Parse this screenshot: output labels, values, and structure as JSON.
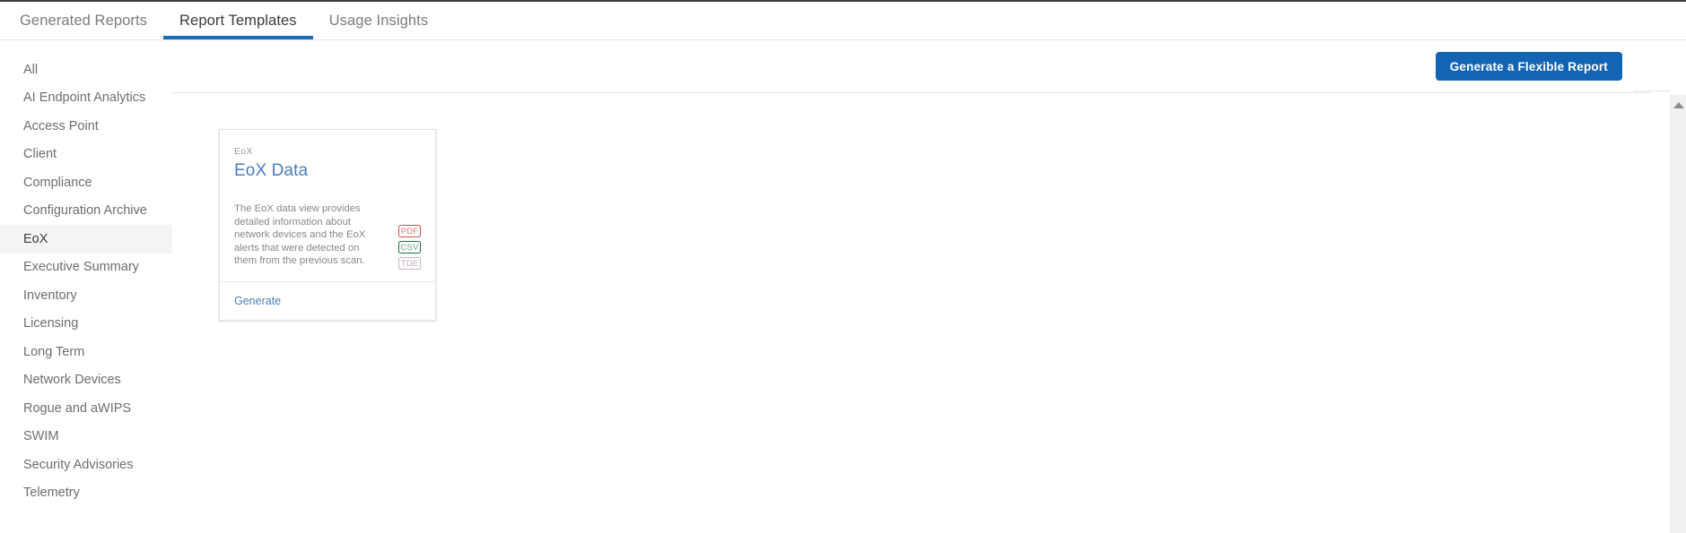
{
  "window": {
    "accent_blue": "#1464b4",
    "link_blue": "#4a7ebb",
    "tab_underline": "#1a6cb0"
  },
  "tabs": [
    {
      "label": "Generated Reports",
      "active": false
    },
    {
      "label": "Report Templates",
      "active": true
    },
    {
      "label": "Usage Insights",
      "active": false
    }
  ],
  "sidebar": {
    "items": [
      {
        "label": "All",
        "selected": false
      },
      {
        "label": "AI Endpoint Analytics",
        "selected": false
      },
      {
        "label": "Access Point",
        "selected": false
      },
      {
        "label": "Client",
        "selected": false
      },
      {
        "label": "Compliance",
        "selected": false
      },
      {
        "label": "Configuration Archive",
        "selected": false
      },
      {
        "label": "EoX",
        "selected": true
      },
      {
        "label": "Executive Summary",
        "selected": false
      },
      {
        "label": "Inventory",
        "selected": false
      },
      {
        "label": "Licensing",
        "selected": false
      },
      {
        "label": "Long Term",
        "selected": false
      },
      {
        "label": "Network Devices",
        "selected": false
      },
      {
        "label": "Rogue and aWIPS",
        "selected": false
      },
      {
        "label": "SWIM",
        "selected": false
      },
      {
        "label": "Security Advisories",
        "selected": false
      },
      {
        "label": "Telemetry",
        "selected": false
      }
    ]
  },
  "toolbar": {
    "generate_flexible_report_label": "Generate a Flexible Report"
  },
  "cards": [
    {
      "category": "EoX",
      "title": "EoX Data",
      "description": "The EoX data view provides detailed information about network devices and the EoX alerts that were detected on them from the previous scan.",
      "formats": [
        {
          "label": "PDF",
          "border": "#d2504f",
          "text": "#dc7f7e"
        },
        {
          "label": "CSV",
          "border": "#17753b",
          "text": "#62a97e"
        },
        {
          "label": "TDE",
          "border": "#cbb2cb",
          "text": "#c6aec6"
        }
      ],
      "generate_label": "Generate"
    }
  ],
  "scrollbar": {
    "up_arrow_name": "scroll-up-arrow"
  }
}
